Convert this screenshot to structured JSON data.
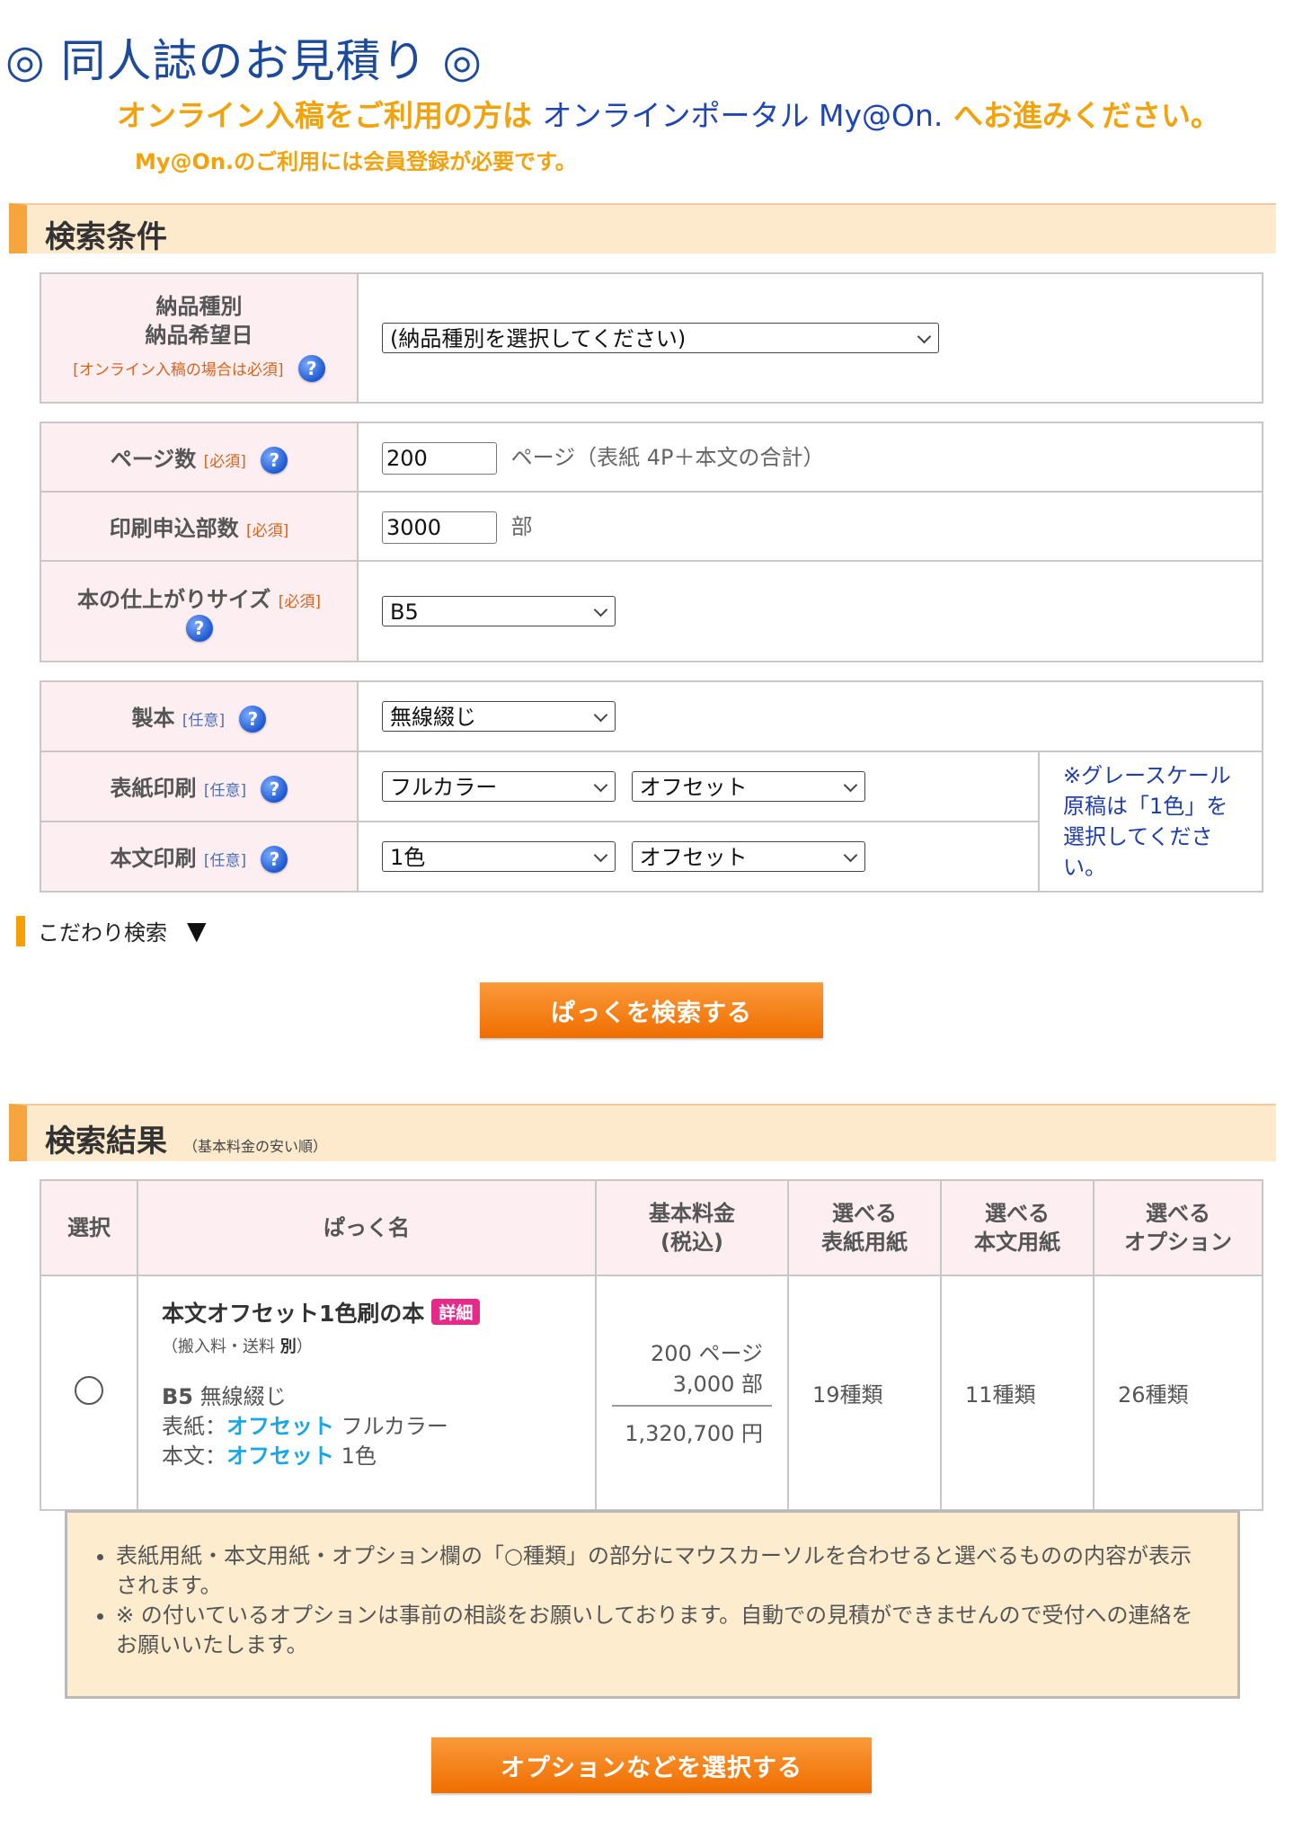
{
  "header": {
    "title": "◎ 同人誌のお見積り ◎",
    "notice_prefix": "オンライン入稿をご利用の方は",
    "notice_link": "オンラインポータル My@On.",
    "notice_suffix": "へお進みください。",
    "notice_sub": "My@On.のご利用には会員登録が必要です。"
  },
  "search": {
    "section_title": "検索条件",
    "delivery": {
      "label_line1": "納品種別",
      "label_line2": "納品希望日",
      "label_note": "[オンライン入稿の場合は必須]",
      "select_value": "(納品種別を選択してください)"
    },
    "pages": {
      "label": "ページ数",
      "badge": "[必須]",
      "value": "200",
      "unit": "ページ（表紙 4P＋本文の合計）"
    },
    "copies": {
      "label": "印刷申込部数",
      "badge": "[必須]",
      "value": "3000",
      "unit": "部"
    },
    "size": {
      "label": "本の仕上がりサイズ",
      "badge": "[必須]",
      "select_value": "B5"
    },
    "binding": {
      "label": "製本",
      "badge": "[任意]",
      "select_value": "無線綴じ"
    },
    "cover_print": {
      "label": "表紙印刷",
      "badge": "[任意]",
      "color_value": "フルカラー",
      "method_value": "オフセット"
    },
    "body_print": {
      "label": "本文印刷",
      "badge": "[任意]",
      "color_value": "1色",
      "method_value": "オフセット"
    },
    "grayscale_note": "※グレースケール原稿は「1色」を選択してください。",
    "help_icon_glyph": "?",
    "advanced_label": "こだわり検索",
    "advanced_toggle": "▼",
    "search_button": "ぱっくを検索する"
  },
  "results": {
    "section_title": "検索結果",
    "section_sub": "（基本料金の安い順）",
    "columns": {
      "select": "選択",
      "pack_name": "ぱっく名",
      "price_line1": "基本料金",
      "price_line2": "(税込)",
      "cover_paper_line1": "選べる",
      "cover_paper_line2": "表紙用紙",
      "body_paper_line1": "選べる",
      "body_paper_line2": "本文用紙",
      "options_line1": "選べる",
      "options_line2": "オプション"
    },
    "rows": [
      {
        "name": "本文オフセット1色刷の本",
        "detail_badge": "詳細",
        "sub_open": "（搬入料・送料 ",
        "sub_bold": "別",
        "sub_close": "）",
        "spec_size": "B5",
        "spec_binding": "無線綴じ",
        "spec_cover_label": "表紙：",
        "spec_cover_method": "オフセット",
        "spec_cover_color": "フルカラー",
        "spec_body_label": "本文：",
        "spec_body_method": "オフセット",
        "spec_body_color": "1色",
        "price_pages": "200 ページ",
        "price_copies": "3,000 部",
        "price_total": "1,320,700 円",
        "cover_papers": "19種類",
        "body_papers": "11種類",
        "options": "26種類"
      }
    ]
  },
  "notes": [
    "表紙用紙・本文用紙・オプション欄の「○種類」の部分にマウスカーソルを合わせると選べるものの内容が表示されます。",
    "※ の付いているオプションは事前の相談をお願いしております。自動での見積ができませんので受付への連絡をお願いいたします。"
  ],
  "select_options_button": "オプションなどを選択する",
  "colors": {
    "title_blue": "#1e4a9a",
    "notice_orange": "#f2a20c",
    "link_blue": "#1f45b5",
    "button_orange": "#ef6e00",
    "label_pink": "#fdeef2",
    "section_beige": "#fde9cc",
    "highlight_cyan": "#17a6e8"
  }
}
